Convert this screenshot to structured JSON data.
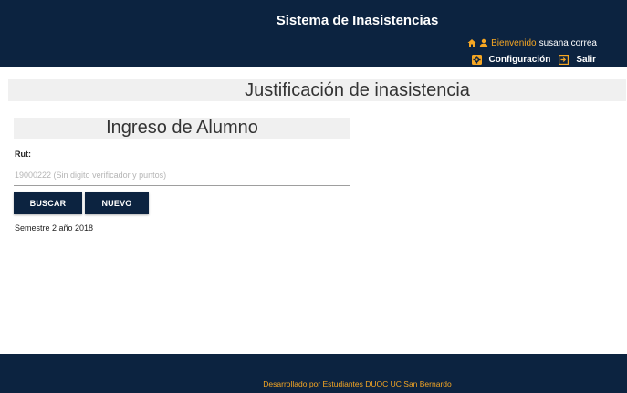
{
  "header": {
    "title": "Sistema de Inasistencias",
    "welcome_label": "Bienvenido",
    "username": "susana correa",
    "config_label": "Configuración",
    "exit_label": "Salir",
    "home_icon": "home-icon",
    "user_icon": "user-icon",
    "settings_icon": "settings-icon",
    "exit_icon": "exit-icon",
    "bg_color": "#0c2340",
    "accent_color": "#f5a623"
  },
  "page": {
    "heading": "Justificación de inasistencia"
  },
  "form": {
    "section_title": "Ingreso de Alumno",
    "rut_label": "Rut:",
    "rut_placeholder": "19000222 (Sin digito verificador y puntos)",
    "rut_value": "",
    "search_button": "BUSCAR",
    "new_button": "NUEVO",
    "semester_text": "Semestre 2 año 2018"
  },
  "footer": {
    "text": "Desarrollado por Estudiantes DUOC UC San Bernardo"
  }
}
